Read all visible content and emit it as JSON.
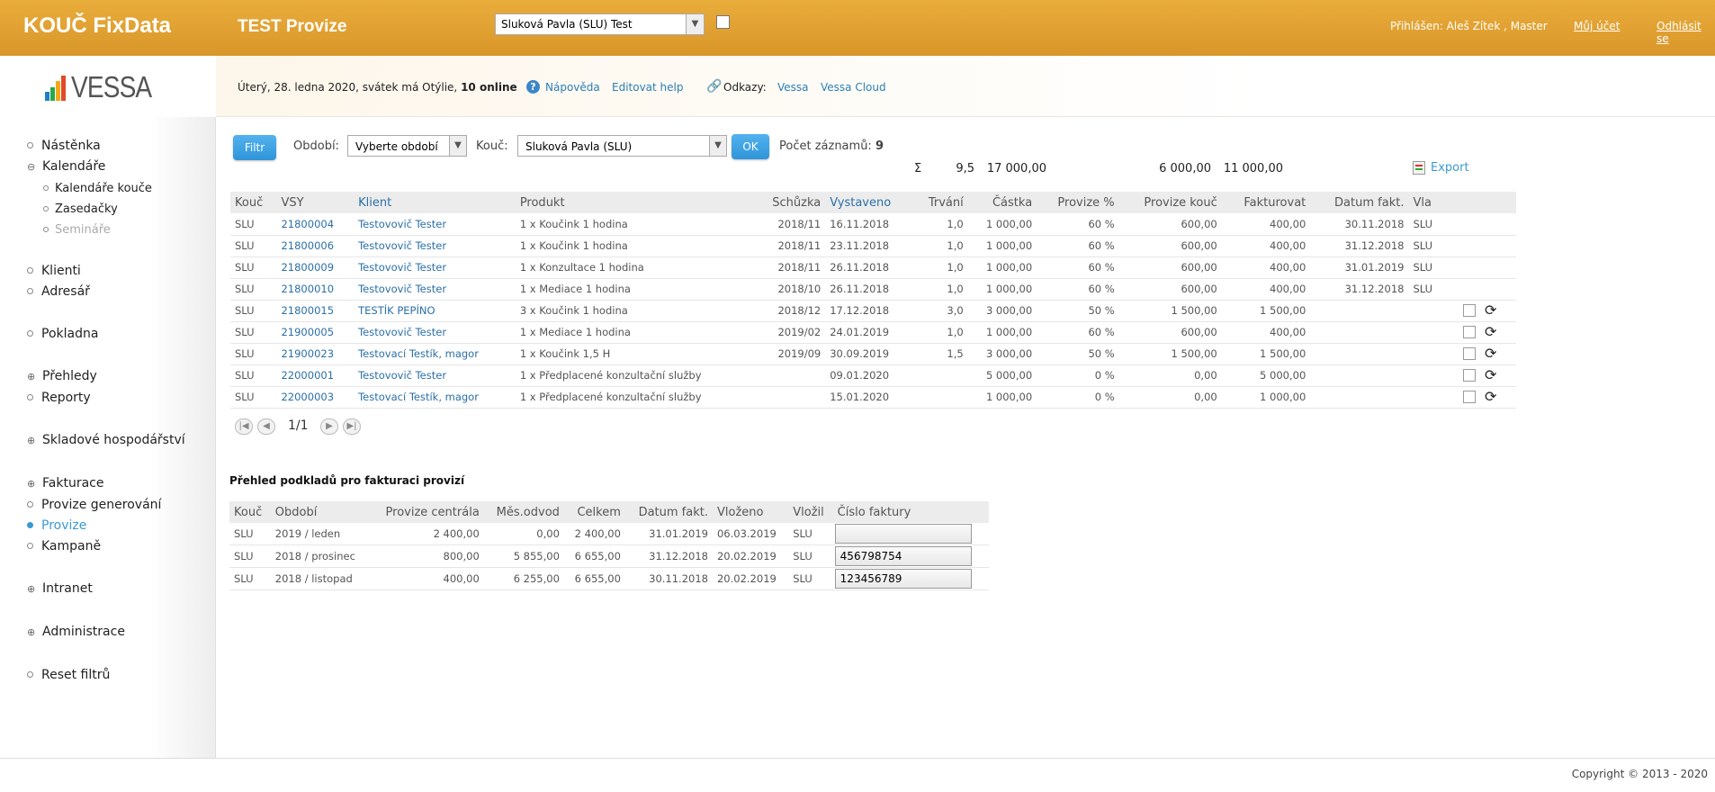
{
  "header": {
    "brand": "KOUČ FixData",
    "title": "TEST Provize",
    "coach_select": "Sluková Pavla (SLU) Test",
    "user": "Přihlášen: Aleš Zítek , Master",
    "account_link": "Můj účet",
    "logout_link": "Odhlásit se"
  },
  "logo": {
    "text": "VESSA",
    "bar_colors": [
      "#1f7fc8",
      "#2aa84a",
      "#f1a81c",
      "#e24a26"
    ]
  },
  "infobar": {
    "date_text": "Úterý, 28. ledna 2020, svátek má Otýlie,",
    "online": "10 online",
    "help_link": "Nápověda",
    "edit_help_link": "Editovat help",
    "links_label": "Odkazy:",
    "link_vessa": "Vessa",
    "link_cloud": "Vessa Cloud"
  },
  "sidebar": {
    "nastenka": "Nástěnka",
    "kalendare": "Kalendáře",
    "kalendare_kouce": "Kalendáře kouče",
    "zasedacky": "Zasedačky",
    "seminare": "Semináře",
    "klienti": "Klienti",
    "adresar": "Adresář",
    "pokladna": "Pokladna",
    "prehledy": "Přehledy",
    "reporty": "Reporty",
    "sklad": "Skladové hospodářství",
    "fakturace": "Fakturace",
    "provize_gen": "Provize generování",
    "provize": "Provize",
    "kampane": "Kampaně",
    "intranet": "Intranet",
    "administrace": "Administrace",
    "reset": "Reset filtrů"
  },
  "filter": {
    "filter_button": "Filtr",
    "period_label": "Období:",
    "period_value": "Vyberte období",
    "coach_label": "Kouč:",
    "coach_value": "Sluková Pavla (SLU)",
    "ok_button": "OK",
    "count_label": "Počet záznamů:",
    "count_value": "9"
  },
  "sums": {
    "sigma": "Σ",
    "trvani": "9,5",
    "castka": "17 000,00",
    "provize_kouc": "6 000,00",
    "fakturovat": "11 000,00"
  },
  "export_label": "Export",
  "table": {
    "headers": [
      "Kouč",
      "VSY",
      "Klient",
      "Produkt",
      "Schůzka",
      "Vystaveno",
      "Trvání",
      "Částka",
      "Provize %",
      "Provize kouč",
      "Fakturovat",
      "Datum fakt.",
      "Vla"
    ],
    "rows": [
      {
        "kouc": "SLU",
        "vsy": "21800004",
        "klient": "Testovovič Tester",
        "produkt": "1 x Koučink 1 hodina",
        "schuzka": "2018/11",
        "vystaveno": "16.11.2018",
        "trvani": "1,0",
        "castka": "1 000,00",
        "provize": "60 %",
        "provize_kouc": "600,00",
        "fakturovat": "400,00",
        "datum": "30.11.2018",
        "vla": "SLU",
        "actions": false
      },
      {
        "kouc": "SLU",
        "vsy": "21800006",
        "klient": "Testovovič Tester",
        "produkt": "1 x Koučink 1 hodina",
        "schuzka": "2018/11",
        "vystaveno": "23.11.2018",
        "trvani": "1,0",
        "castka": "1 000,00",
        "provize": "60 %",
        "provize_kouc": "600,00",
        "fakturovat": "400,00",
        "datum": "31.12.2018",
        "vla": "SLU",
        "actions": false
      },
      {
        "kouc": "SLU",
        "vsy": "21800009",
        "klient": "Testovovič Tester",
        "produkt": "1 x Konzultace 1 hodina",
        "schuzka": "2018/11",
        "vystaveno": "26.11.2018",
        "trvani": "1,0",
        "castka": "1 000,00",
        "provize": "60 %",
        "provize_kouc": "600,00",
        "fakturovat": "400,00",
        "datum": "31.01.2019",
        "vla": "SLU",
        "actions": false
      },
      {
        "kouc": "SLU",
        "vsy": "21800010",
        "klient": "Testovovič Tester",
        "produkt": "1 x Mediace 1 hodina",
        "schuzka": "2018/10",
        "vystaveno": "26.11.2018",
        "trvani": "1,0",
        "castka": "1 000,00",
        "provize": "60 %",
        "provize_kouc": "600,00",
        "fakturovat": "400,00",
        "datum": "31.12.2018",
        "vla": "SLU",
        "actions": false
      },
      {
        "kouc": "SLU",
        "vsy": "21800015",
        "klient": "TESTÍK PEPÍNO",
        "produkt": "3 x Koučink 1 hodina",
        "schuzka": "2018/12",
        "vystaveno": "17.12.2018",
        "trvani": "3,0",
        "castka": "3 000,00",
        "provize": "50 %",
        "provize_kouc": "1 500,00",
        "fakturovat": "1 500,00",
        "datum": "",
        "vla": "",
        "actions": true
      },
      {
        "kouc": "SLU",
        "vsy": "21900005",
        "klient": "Testovovič Tester",
        "produkt": "1 x Mediace 1 hodina",
        "schuzka": "2019/02",
        "vystaveno": "24.01.2019",
        "trvani": "1,0",
        "castka": "1 000,00",
        "provize": "60 %",
        "provize_kouc": "600,00",
        "fakturovat": "400,00",
        "datum": "",
        "vla": "",
        "actions": true
      },
      {
        "kouc": "SLU",
        "vsy": "21900023",
        "klient": "Testovací Testík, magor",
        "produkt": "1 x Koučink 1,5 H",
        "schuzka": "2019/09",
        "vystaveno": "30.09.2019",
        "trvani": "1,5",
        "castka": "3 000,00",
        "provize": "50 %",
        "provize_kouc": "1 500,00",
        "fakturovat": "1 500,00",
        "datum": "",
        "vla": "",
        "actions": true
      },
      {
        "kouc": "SLU",
        "vsy": "22000001",
        "klient": "Testovovič Tester",
        "produkt": "1 x Předplacené konzultační služby",
        "schuzka": "",
        "vystaveno": "09.01.2020",
        "trvani": "",
        "castka": "5 000,00",
        "provize": "0 %",
        "provize_kouc": "0,00",
        "fakturovat": "5 000,00",
        "datum": "",
        "vla": "",
        "actions": true
      },
      {
        "kouc": "SLU",
        "vsy": "22000003",
        "klient": "Testovací Testík, magor",
        "produkt": "1 x Předplacené konzultační služby",
        "schuzka": "",
        "vystaveno": "15.01.2020",
        "trvani": "",
        "castka": "1 000,00",
        "provize": "0 %",
        "provize_kouc": "0,00",
        "fakturovat": "1 000,00",
        "datum": "",
        "vla": "",
        "actions": true
      }
    ]
  },
  "pager": {
    "text": "1/1"
  },
  "summary": {
    "title": "Přehled podkladů pro fakturaci provizí",
    "headers": [
      "Kouč",
      "Období",
      "Provize centrála",
      "Měs.odvod",
      "Celkem",
      "Datum fakt.",
      "Vloženo",
      "Vložil",
      "Číslo faktury"
    ],
    "rows": [
      {
        "kouc": "SLU",
        "obdobi": "2019 / leden",
        "centrala": "2 400,00",
        "odvod": "0,00",
        "celkem": "2 400,00",
        "datum": "31.01.2019",
        "vlozeno": "06.03.2019",
        "vlozil": "SLU",
        "cislo": ""
      },
      {
        "kouc": "SLU",
        "obdobi": "2018 / prosinec",
        "centrala": "800,00",
        "odvod": "5 855,00",
        "celkem": "6 655,00",
        "datum": "31.12.2018",
        "vlozeno": "20.02.2019",
        "vlozil": "SLU",
        "cislo": "456798754"
      },
      {
        "kouc": "SLU",
        "obdobi": "2018 / listopad",
        "centrala": "400,00",
        "odvod": "6 255,00",
        "celkem": "6 655,00",
        "datum": "30.11.2018",
        "vlozeno": "20.02.2019",
        "vlozil": "SLU",
        "cislo": "123456789"
      }
    ]
  },
  "footer": "Copyright © 2013 - 2020"
}
